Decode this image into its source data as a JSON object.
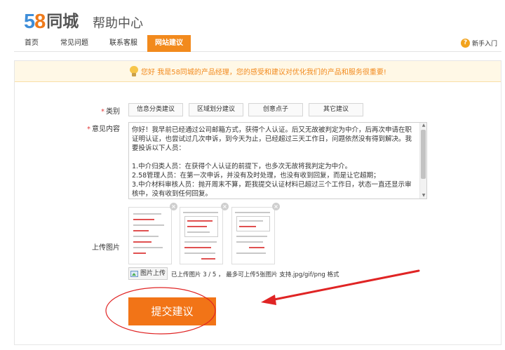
{
  "header": {
    "logo_number": "58",
    "logo_name": "同城",
    "subtitle": "帮助中心"
  },
  "nav": {
    "items": [
      {
        "label": "首页"
      },
      {
        "label": "常见问题"
      },
      {
        "label": "联系客服"
      },
      {
        "label": "网站建议"
      }
    ],
    "active_index": 3,
    "newbie_label": "新手入门",
    "accent_color": "#f28a1d"
  },
  "notice": "您好 我是58同城的产品经理，您的感受和建议对优化我们的产品和服务很重要!",
  "form": {
    "category_label": "类别",
    "categories": [
      "信息分类建议",
      "区域划分建议",
      "创意点子",
      "其它建议"
    ],
    "opinion_label": "意见内容",
    "required_mark": "*",
    "opinion_text": [
      "你好！我早前已经通过公司邮箱方式，获得个人认证。后又无故被判定为中介，后再次申请在职证明认证，也尝试过几次申诉，到今天为止，已经超过三天工作日，问题依然没有得到解决。我要投诉以下人员：",
      "1.中介归类人员：在获得个人认证的前提下，也多次无故将我判定为中介。",
      "2.58管理人员：在第一次申诉，并没有及时处理，也没有收到回复，而是让它超期；",
      "3.中介材料审核人员：抛开周末不算，距我提交认证材料已超过三个工作日，状态一直还显示审核中，没有收到任何回复。"
    ],
    "upload_label": "上传图片",
    "upload_button": "图片上传",
    "upload_hint": "已上传图片 3 / 5 ， 最多可上传5张图片 支持.jpg/gif/png 格式",
    "uploaded_count": 3,
    "max_count": 5,
    "submit_label": "提交建议",
    "submit_color": "#f27417"
  },
  "annotation_color": "#e02424"
}
